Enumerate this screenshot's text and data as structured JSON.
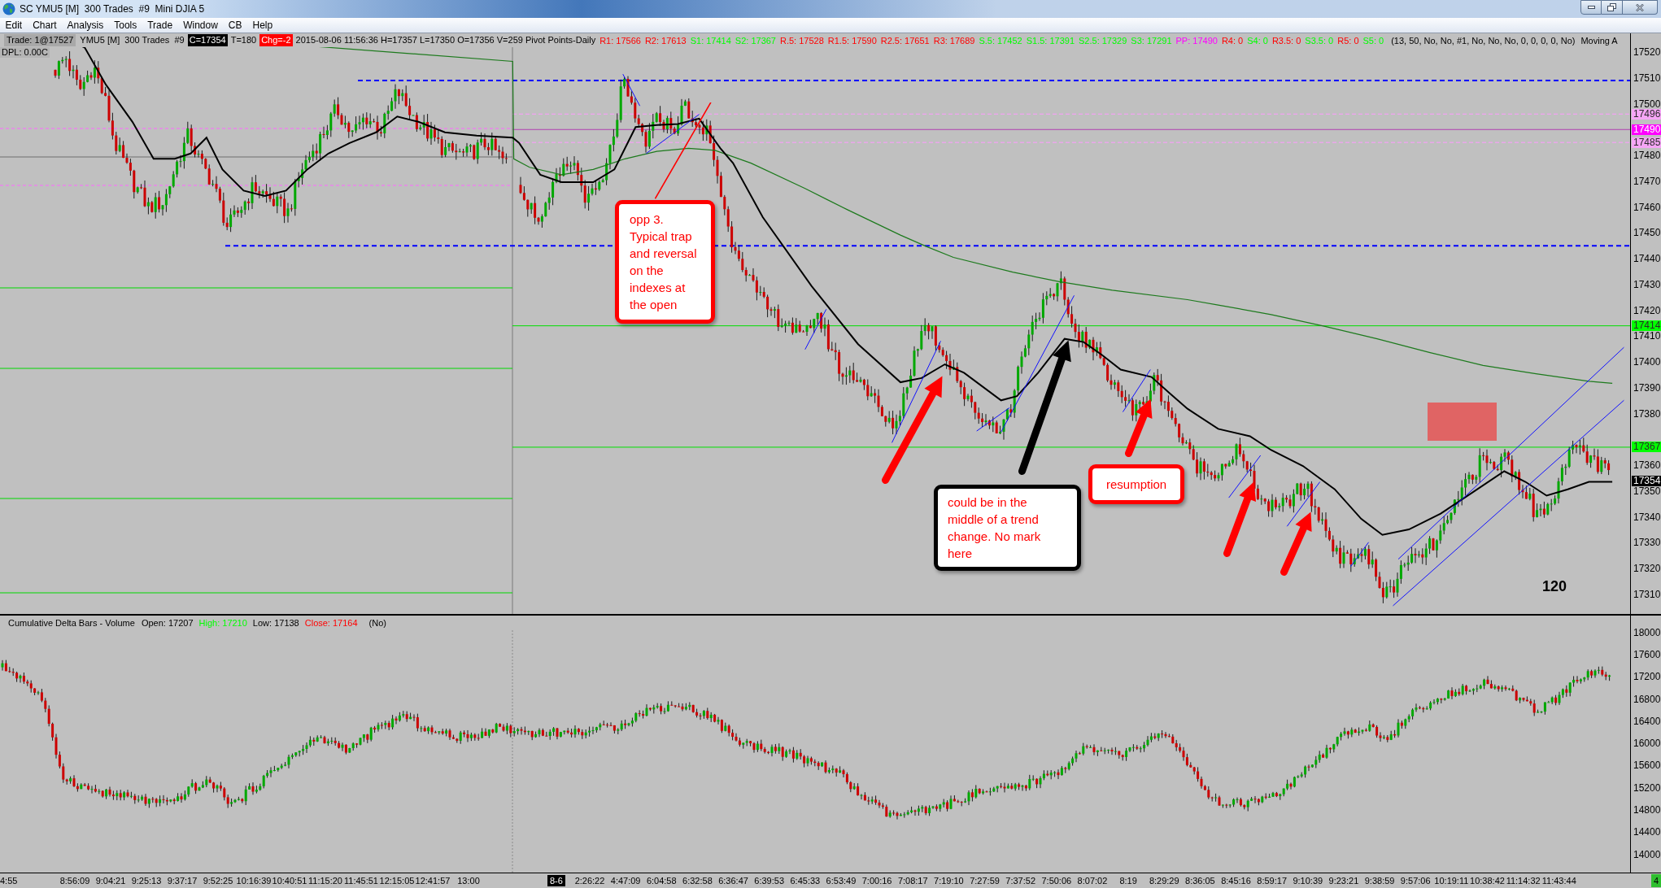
{
  "window": {
    "title": "SC YMU5 [M]  300 Trades  #9  Mini DJIA 5"
  },
  "menu": [
    "Edit",
    "Chart",
    "Analysis",
    "Tools",
    "Trade",
    "Window",
    "CB",
    "Help"
  ],
  "info_bar": {
    "trade": "Trade: 1@17527",
    "fields": [
      {
        "kind": "plain",
        "text": "YMU5 [M]  300 Trades  #9"
      },
      {
        "kind": "close",
        "text": "C=17354"
      },
      {
        "kind": "plain",
        "text": "T=180"
      },
      {
        "kind": "change",
        "text": "Chg=-2"
      },
      {
        "kind": "plain",
        "text": "2015-08-06 11:56:36 H=17357 L=17350 O=17356 V=259 Pivot Points-Daily"
      }
    ],
    "pivots": [
      {
        "text": "R1: 17566",
        "color": "#ff0000"
      },
      {
        "text": "R2: 17613",
        "color": "#ff0000"
      },
      {
        "text": "S1: 17414",
        "color": "#00ff00"
      },
      {
        "text": "S2: 17367",
        "color": "#00ff00"
      },
      {
        "text": "R.5: 17528",
        "color": "#ff0000"
      },
      {
        "text": "R1.5: 17590",
        "color": "#ff0000"
      },
      {
        "text": "R2.5: 17651",
        "color": "#ff0000"
      },
      {
        "text": "R3: 17689",
        "color": "#ff0000"
      },
      {
        "text": "S.5: 17452",
        "color": "#00ff00"
      },
      {
        "text": "S1.5: 17391",
        "color": "#00ff00"
      },
      {
        "text": "S2.5: 17329",
        "color": "#00ff00"
      },
      {
        "text": "S3: 17291",
        "color": "#00ff00"
      },
      {
        "text": "PP: 17490",
        "color": "#ff00ff"
      },
      {
        "text": "R4: 0",
        "color": "#ff0000"
      },
      {
        "text": "S4: 0",
        "color": "#00ff00"
      },
      {
        "text": "R3.5: 0",
        "color": "#ff0000"
      },
      {
        "text": "S3.5: 0",
        "color": "#00ff00"
      },
      {
        "text": "R5: 0",
        "color": "#ff0000"
      },
      {
        "text": "S5: 0",
        "color": "#00ff00"
      }
    ],
    "params": "(13, 50, No, No, #1, No, No, No, 0, 0, 0, 0, No)",
    "study": "Moving A"
  },
  "dpl": "DPL: 0.00C",
  "callouts": [
    {
      "text": "opp 3. Typical trap and reversal on the indexes at the open",
      "color": "#ff0000"
    },
    {
      "text": "could be in the middle of a trend change. No mark here",
      "color": "#000000"
    },
    {
      "text": "resumption",
      "color": "#ff0000"
    }
  ],
  "chart_note": "120",
  "price_axis": {
    "ticks": [
      "17520",
      "17510",
      "17500",
      "17480",
      "17470",
      "17460",
      "17450",
      "17440",
      "17430",
      "17420",
      "17410",
      "17400",
      "17390",
      "17380",
      "17360",
      "17350",
      "17340",
      "17330",
      "17320",
      "17310"
    ],
    "markers": [
      {
        "text": "17496",
        "color": "#f6a6f6"
      },
      {
        "text": "17490",
        "color": "#ff00ff"
      },
      {
        "text": "17485",
        "color": "#f6a6f6"
      },
      {
        "text": "17414",
        "color": "#00ff00"
      },
      {
        "text": "17367",
        "color": "#00ff00"
      },
      {
        "text": "17354",
        "color": "#000000"
      }
    ]
  },
  "lower_pane": {
    "title": "Cumulative Delta Bars - Volume",
    "values": [
      {
        "text": "Open: 17207",
        "color": "#000000"
      },
      {
        "text": "High: 17210",
        "color": "#00ff00"
      },
      {
        "text": "Low: 17138",
        "color": "#000000"
      },
      {
        "text": "Close: 17164",
        "color": "#ff0000"
      }
    ],
    "params": "(No)"
  },
  "lower_axis": {
    "ticks": [
      "18000",
      "17600",
      "17200",
      "16800",
      "16400",
      "16000",
      "15600",
      "15200",
      "14800",
      "14400",
      "14000"
    ]
  },
  "time_axis": {
    "labels": [
      {
        "kind": "time",
        "text": "4:55"
      },
      {
        "kind": "time",
        "text": "8:56:09"
      },
      {
        "kind": "time",
        "text": "9:04:21"
      },
      {
        "kind": "time",
        "text": "9:25:13"
      },
      {
        "kind": "time",
        "text": "9:37:17"
      },
      {
        "kind": "time",
        "text": "9:52:25"
      },
      {
        "kind": "time",
        "text": "10:16:39"
      },
      {
        "kind": "time",
        "text": "10:40:51"
      },
      {
        "kind": "time",
        "text": "11:15:20"
      },
      {
        "kind": "time",
        "text": "11:45:51"
      },
      {
        "kind": "time",
        "text": "12:15:05"
      },
      {
        "kind": "time",
        "text": "12:41:57"
      },
      {
        "kind": "time",
        "text": "13:00"
      },
      {
        "kind": "date",
        "text": "8-6"
      },
      {
        "kind": "time",
        "text": "2:26:22"
      },
      {
        "kind": "time",
        "text": "4:47:09"
      },
      {
        "kind": "time",
        "text": "6:04:58"
      },
      {
        "kind": "time",
        "text": "6:32:58"
      },
      {
        "kind": "time",
        "text": "6:36:47"
      },
      {
        "kind": "time",
        "text": "6:39:53"
      },
      {
        "kind": "time",
        "text": "6:45:33"
      },
      {
        "kind": "time",
        "text": "6:53:49"
      },
      {
        "kind": "time",
        "text": "7:00:16"
      },
      {
        "kind": "time",
        "text": "7:08:17"
      },
      {
        "kind": "time",
        "text": "7:19:10"
      },
      {
        "kind": "time",
        "text": "7:27:59"
      },
      {
        "kind": "time",
        "text": "7:37:52"
      },
      {
        "kind": "time",
        "text": "7:50:06"
      },
      {
        "kind": "time",
        "text": "8:07:02"
      },
      {
        "kind": "time",
        "text": "8:19"
      },
      {
        "kind": "time",
        "text": "8:29:29"
      },
      {
        "kind": "time",
        "text": "8:36:05"
      },
      {
        "kind": "time",
        "text": "8:45:16"
      },
      {
        "kind": "time",
        "text": "8:59:17"
      },
      {
        "kind": "time",
        "text": "9:10:39"
      },
      {
        "kind": "time",
        "text": "9:23:21"
      },
      {
        "kind": "time",
        "text": "9:38:59"
      },
      {
        "kind": "time",
        "text": "9:57:06"
      },
      {
        "kind": "time",
        "text": "10:19:11"
      },
      {
        "kind": "time",
        "text": "10:38:42"
      },
      {
        "kind": "time",
        "text": "11:14:32"
      },
      {
        "kind": "time",
        "text": "11:43:44"
      }
    ],
    "counter": "4"
  }
}
